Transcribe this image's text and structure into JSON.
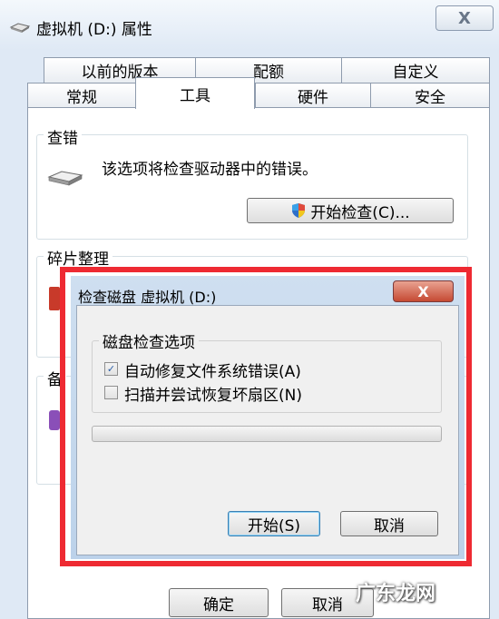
{
  "window": {
    "title": "虚拟机 (D:) 属性",
    "close_glyph": "X"
  },
  "tabs_row1": [
    "以前的版本",
    "配额",
    "自定义"
  ],
  "tabs_row2": [
    "常规",
    "工具",
    "硬件",
    "安全"
  ],
  "error_check": {
    "title": "查错",
    "description": "该选项将检查驱动器中的错误。",
    "button": "开始检查(C)..."
  },
  "defrag": {
    "title": "碎片整理"
  },
  "backup": {
    "title": "备"
  },
  "footer": {
    "ok": "确定",
    "cancel": "取消"
  },
  "modal": {
    "title": "检查磁盘 虚拟机 (D:)",
    "close_glyph": "X",
    "options_title": "磁盘检查选项",
    "option1": {
      "label": "自动修复文件系统错误(A)",
      "checked": true,
      "mark": "✓"
    },
    "option2": {
      "label": "扫描并尝试恢复坏扇区(N)",
      "checked": false
    },
    "progress": 0,
    "start": "开始(S)",
    "cancel": "取消"
  },
  "watermark": "广东龙网",
  "colors": {
    "highlight": "#ee2a32",
    "accent": "#2a5fa8"
  }
}
